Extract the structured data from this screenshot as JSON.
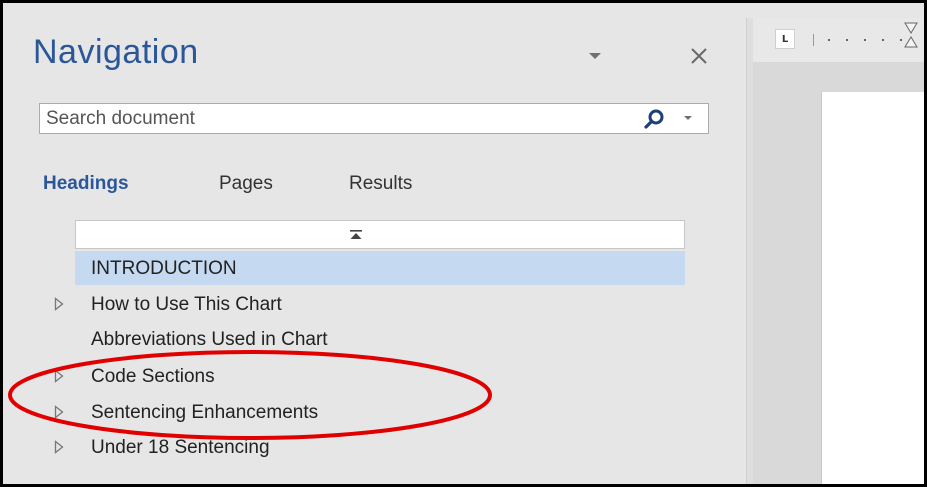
{
  "navigation_pane": {
    "title": "Navigation",
    "search": {
      "placeholder": "Search document",
      "value": ""
    },
    "tabs": [
      {
        "label": "Headings",
        "active": true
      },
      {
        "label": "Pages",
        "active": false
      },
      {
        "label": "Results",
        "active": false
      }
    ],
    "headings": [
      {
        "label": "INTRODUCTION",
        "expandable": false,
        "selected": true
      },
      {
        "label": "How to Use This Chart",
        "expandable": true,
        "selected": false
      },
      {
        "label": "Abbreviations Used in Chart",
        "expandable": false,
        "selected": false
      },
      {
        "label": "Code Sections",
        "expandable": true,
        "selected": false
      },
      {
        "label": "Sentencing Enhancements",
        "expandable": true,
        "selected": false
      },
      {
        "label": "Under 18 Sentencing",
        "expandable": true,
        "selected": false
      }
    ]
  },
  "ruler": {
    "tab_selector": "L"
  },
  "annotation": {
    "shape": "ellipse",
    "color": "#e00000"
  },
  "colors": {
    "accent": "#2b579a",
    "selection": "#c5d9f1",
    "pane_background": "#e6e6e6"
  },
  "icons": [
    "chevron-down-icon",
    "close-icon",
    "search-icon",
    "collapse-all-icon",
    "expand-triangle-icon"
  ]
}
